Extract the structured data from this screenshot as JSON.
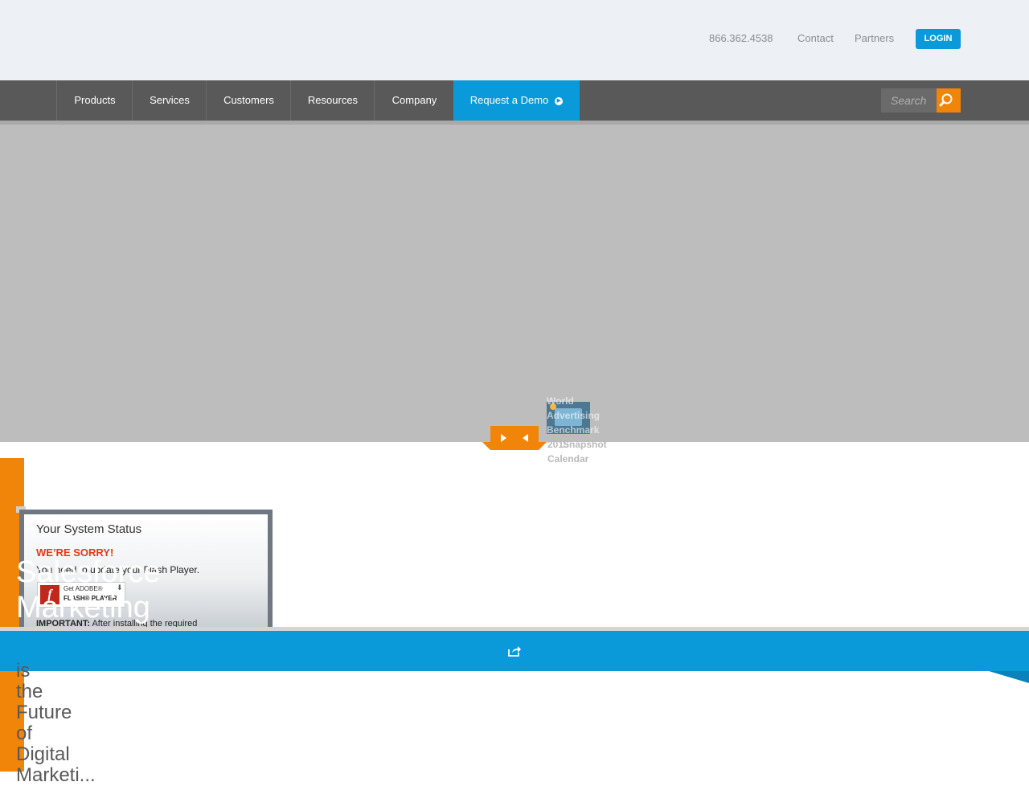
{
  "header": {
    "phone": "866.362.4538",
    "contact_label": "Contact",
    "partners_label": "Partners",
    "login_label": "LOGIN"
  },
  "nav": {
    "items": [
      {
        "label": "Products"
      },
      {
        "label": "Services"
      },
      {
        "label": "Customers"
      },
      {
        "label": "Resources"
      },
      {
        "label": "Company"
      }
    ],
    "demo_label": "Request a Demo",
    "search_placeholder": "Search"
  },
  "slider": {
    "next_icon": "play-right-icon",
    "prev_icon": "play-left-icon",
    "thumbnail_texts": [
      "World",
      "Advertising",
      "Benchmark",
      "Calendar",
      "2015",
      "Snapshot"
    ]
  },
  "flash_notice": {
    "title": "Your System Status",
    "sorry": "WE’RE SORRY!",
    "message": "You need to update your Flash Player.",
    "badge_get": "Get ADOBE®",
    "badge_player": "FLASH® PLAYER",
    "important_label": "IMPORTANT:",
    "important_text": "After installing the required"
  },
  "hero_text": {
    "heading_line1": "Salesforce",
    "heading_line2": "Marketing",
    "sub_words": [
      "is",
      "the",
      "Future",
      "of",
      "Digital",
      "Marketi..."
    ]
  },
  "share": {
    "icon": "share-icon"
  },
  "colors": {
    "accent_blue": "#0a9ad9",
    "accent_orange": "#f0850a",
    "nav_bg": "#595959",
    "top_bg": "#edf1f5"
  }
}
